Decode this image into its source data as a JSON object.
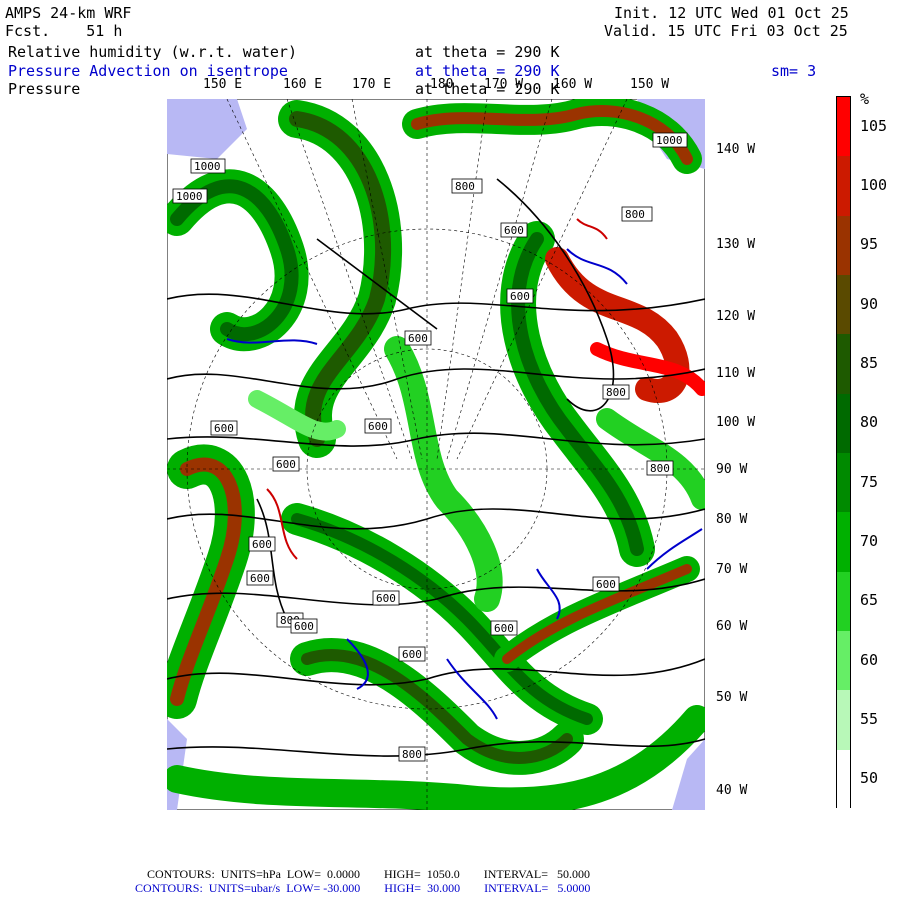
{
  "header": {
    "model": "AMPS 24-km WRF",
    "fcst": "Fcst.    51 h",
    "init": "Init. 12 UTC Wed 01 Oct 25",
    "valid": "Valid. 15 UTC Fri 03 Oct 25"
  },
  "fields": [
    {
      "name": "Relative humidity (w.r.t. water)",
      "level": "at theta = 290 K",
      "color": "#000000"
    },
    {
      "name": "Pressure Advection on isentrope",
      "level": "at theta = 290 K",
      "color": "#0000cc",
      "extra": "sm= 3"
    },
    {
      "name": "Pressure",
      "level": "at theta = 290 K",
      "color": "#000000"
    }
  ],
  "colorbar": {
    "unit": "%",
    "labels": [
      "105",
      "100",
      "95",
      "90",
      "85",
      "80",
      "75",
      "70",
      "65",
      "60",
      "55",
      "50"
    ],
    "colors": [
      "#ff0000",
      "#cc1a00",
      "#9a3300",
      "#5a4a00",
      "#1e5a00",
      "#006a00",
      "#008a00",
      "#00b000",
      "#22d022",
      "#66ee66",
      "#b8f8b8",
      "#ffffff"
    ]
  },
  "map": {
    "top_labels": [
      "150 E",
      "160 E",
      "170 E",
      "180",
      "170 W",
      "160 W",
      "150 W"
    ],
    "right_labels": [
      "140 W",
      "130 W",
      "120 W",
      "110 W",
      "100 W",
      "90 W",
      "80 W",
      "70 W",
      "60 W",
      "50 W",
      "40 W"
    ],
    "pressure_labels": [
      "1000",
      "1000",
      "800",
      "800",
      "600",
      "600",
      "600",
      "1000",
      "800",
      "600",
      "600",
      "600",
      "800",
      "600",
      "600",
      "600",
      "600",
      "800",
      "600",
      "600",
      "600",
      "800"
    ]
  },
  "footer": {
    "line1": "CONTOURS:  UNITS=hPa  LOW=  0.0000        HIGH=  1050.0        INTERVAL=   50.000",
    "line2": "CONTOURS:  UNITS=ubar/s  LOW= -30.000        HIGH=  30.000        INTERVAL=   5.0000"
  }
}
